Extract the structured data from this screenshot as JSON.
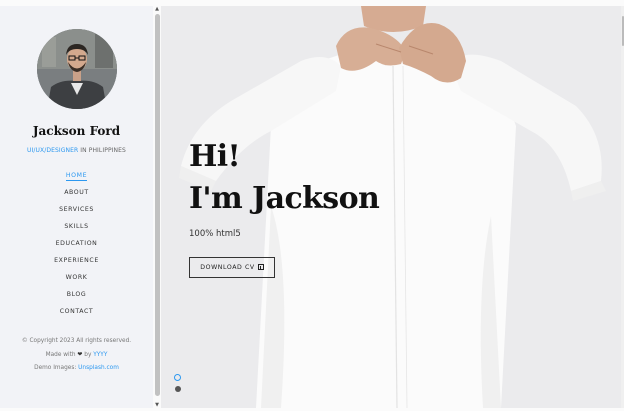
{
  "profile": {
    "name": "Jackson Ford",
    "role_link": "UI/UX/DESIGNER",
    "role_rest": " IN PHILIPPINES"
  },
  "nav": {
    "items": [
      {
        "label": "HOME"
      },
      {
        "label": "ABOUT"
      },
      {
        "label": "SERVICES"
      },
      {
        "label": "SKILLS"
      },
      {
        "label": "EDUCATION"
      },
      {
        "label": "EXPERIENCE"
      },
      {
        "label": "WORK"
      },
      {
        "label": "BLOG"
      },
      {
        "label": "CONTACT"
      }
    ],
    "active": "HOME"
  },
  "footer": {
    "copyright": "© Copyright 2023 All rights reserved.",
    "made_with": "Made with",
    "heart_icon": "heart-icon",
    "by": " by ",
    "author_link": "YYYY",
    "demo_images": "Demo Images: ",
    "demo_link": "Unsplash.com"
  },
  "hero": {
    "line1": "Hi!",
    "line2": "I'm Jackson",
    "subtitle": "100% html5",
    "button_label": "DOWNLOAD CV",
    "button_icon": "download-icon"
  },
  "colors": {
    "accent": "#2c98f0",
    "sidebar_bg": "#f2f3f7",
    "text_dark": "#111111"
  }
}
